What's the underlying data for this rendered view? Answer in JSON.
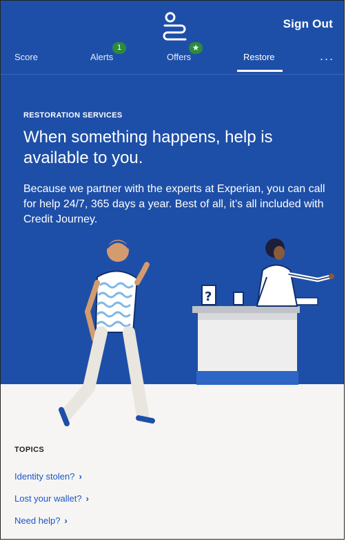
{
  "header": {
    "sign_out_label": "Sign Out",
    "logo_icon": "route-icon"
  },
  "tabs": [
    {
      "label": "Score"
    },
    {
      "label": "Alerts",
      "badge": "1"
    },
    {
      "label": "Offers",
      "badge": "★"
    },
    {
      "label": "Restore",
      "selected": true
    },
    {
      "label": "..."
    }
  ],
  "hero": {
    "eyebrow": "RESTORATION SERVICES",
    "headline": "When something happens, help is available to you.",
    "body": "Because we partner with the experts at Experian, you can call for help 24/7, 365 days a year. Best of all, it’s all included with Credit Journey."
  },
  "topics": {
    "title": "TOPICS",
    "items": [
      {
        "label": "Identity stolen?"
      },
      {
        "label": "Lost your wallet?"
      },
      {
        "label": "Need help?"
      }
    ]
  },
  "colors": {
    "hero_bg": "#1e4fa8",
    "badge_green": "#2e8b3a",
    "link_blue": "#1a56c9",
    "page_bg": "#f6f5f3"
  }
}
